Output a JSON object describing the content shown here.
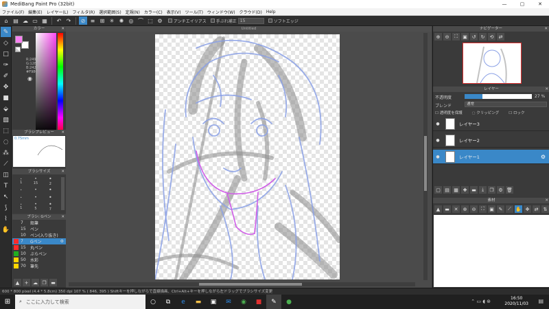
{
  "window": {
    "title": "MediBang Paint Pro (32bit)",
    "controls": [
      "—",
      "▢",
      "✕"
    ]
  },
  "menu": [
    "ファイル(F)",
    "編集(E)",
    "レイヤー(L)",
    "フィルタ(R)",
    "選択範囲(S)",
    "定規(N)",
    "カラー(C)",
    "表示(V)",
    "ツール(T)",
    "ウィンドウ(W)",
    "クラウド(D)",
    "Help"
  ],
  "toolbar": {
    "antialias_label": "アンチエイリアス",
    "stabilizer_label": "手ぶれ補正",
    "stabilizer_value": "15",
    "soft_edge_label": "ソフトエッジ"
  },
  "color_panel": {
    "title": "カラー",
    "r": "R:249",
    "g": "G:128",
    "b": "B:242",
    "hex": "#F980F2",
    "foreground": "#f980f2",
    "background": "#ffffff"
  },
  "brush_preview": {
    "title": "ブラシプレビュー",
    "size_label": "0.75mm"
  },
  "brush_size": {
    "title": "ブラシサイズ",
    "sizes": [
      "1",
      "15",
      "2",
      "",
      "",
      "",
      "",
      "",
      "",
      "1",
      "5",
      "7"
    ]
  },
  "brush_panel": {
    "title": "ブラシ: Gペン",
    "items": [
      {
        "size": "7",
        "name": "鉛筆",
        "color": "#3a3a3a"
      },
      {
        "size": "15",
        "name": "ペン",
        "color": "#3a3a3a"
      },
      {
        "size": "10",
        "name": "ペン(入り抜き)",
        "color": "#3a3a3a"
      },
      {
        "size": "7",
        "name": "Gペン",
        "color": "#ff2a2a"
      },
      {
        "size": "15",
        "name": "丸ペン",
        "color": "#ff2a2a"
      },
      {
        "size": "10",
        "name": "ぶらペン",
        "color": "#1fae1f"
      },
      {
        "size": "50",
        "name": "水彩",
        "color": "#ffd500"
      },
      {
        "size": "70",
        "name": "筆先",
        "color": "#ffd500"
      }
    ]
  },
  "canvas": {
    "tab_title": "Untitled"
  },
  "navigator": {
    "title": "ナビゲーター"
  },
  "layer_panel": {
    "title": "レイヤー",
    "opacity_label": "不透明度",
    "opacity_value": "27 %",
    "opacity_fraction": 0.27,
    "blend_label": "ブレンド",
    "blend_value": "通常",
    "protect_label": "透明度を保護",
    "clipping_label": "クリッピング",
    "lock_label": "ロック",
    "layers": [
      {
        "name": "レイヤー3",
        "selected": false
      },
      {
        "name": "レイヤー2",
        "selected": false
      },
      {
        "name": "レイヤー1",
        "selected": true
      }
    ]
  },
  "material_panel": {
    "title": "素材"
  },
  "status": {
    "text": "600 * 800 pixel  (4.4 * 5.8cm)  350 dpi  107 %  ( 846, 395 )  Shiftキーを押しながらで直線描画、Ctrl+Alt+キーを押しながら左ドラッグでブラシサイズ変更"
  },
  "taskbar": {
    "search_placeholder": "ここに入力して検索",
    "time": "16:50",
    "date": "2020/11/03"
  }
}
